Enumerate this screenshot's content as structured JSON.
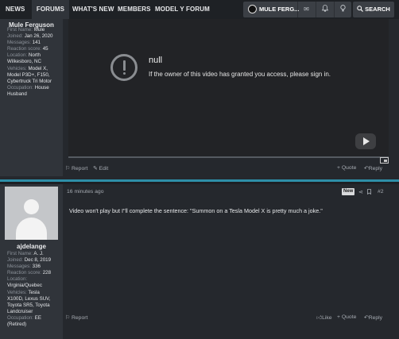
{
  "nav": {
    "tabs": [
      "NEWS",
      "FORUMS",
      "WHAT'S NEW",
      "MEMBERS",
      "MODEL Y FORUM"
    ],
    "user": "MULE FERG...",
    "search_label": "SEARCH",
    "icons": [
      "mail-icon",
      "bell-icon",
      "bulb-icon",
      "search-icon"
    ]
  },
  "post1": {
    "username": "Mule Ferguson",
    "stats": [
      {
        "k": "First Name:",
        "v": "Mule"
      },
      {
        "k": "Joined:",
        "v": "Jan 26, 2020"
      },
      {
        "k": "Messages:",
        "v": "141"
      },
      {
        "k": "Reaction score:",
        "v": "45"
      },
      {
        "k": "Location:",
        "v": "North"
      },
      {
        "k": "",
        "v": "Wilkesboro, NC"
      },
      {
        "k": "Vehicles:",
        "v": "Model X,"
      },
      {
        "k": "",
        "v": "Model P3D+, F150,"
      },
      {
        "k": "",
        "v": "Cybertruck Tri Motor"
      },
      {
        "k": "Occupation:",
        "v": "House"
      },
      {
        "k": "",
        "v": "Husband"
      }
    ],
    "video_error_title": "null",
    "video_error_message": "If the owner of this video has granted you access, please sign in.",
    "actions": {
      "report": "Report",
      "edit": "Edit",
      "quote": "+ Quote",
      "reply": "Reply"
    }
  },
  "post2": {
    "username": "ajdelange",
    "time": "16 minutes ago",
    "badge": "New",
    "post_number": "#2",
    "stats": [
      {
        "k": "First Name:",
        "v": "A. J."
      },
      {
        "k": "Joined:",
        "v": "Dec 8, 2019"
      },
      {
        "k": "Messages:",
        "v": "336"
      },
      {
        "k": "Reaction score:",
        "v": "228"
      },
      {
        "k": "Location:",
        "v": ""
      },
      {
        "k": "",
        "v": "Virginia/Quebec"
      },
      {
        "k": "Vehicles:",
        "v": "Tesla"
      },
      {
        "k": "",
        "v": "X100D, Lexus SUV,"
      },
      {
        "k": "",
        "v": "Toyota SR5, Toyota"
      },
      {
        "k": "",
        "v": "Landcruiser"
      },
      {
        "k": "Occupation:",
        "v": "EE"
      },
      {
        "k": "",
        "v": "(Retired)"
      }
    ],
    "body": "Video won't play but I\"ll complete the sentence: \"Summon on a Tesla Model X is pretty much a joke.\"",
    "actions": {
      "report": "Report",
      "like": "Like",
      "quote": "+ Quote",
      "reply": "Reply"
    }
  },
  "colors": {
    "accent": "#2e8fa8",
    "panel": "#30343a",
    "background": "#25282d",
    "nav": "#1e2125"
  }
}
